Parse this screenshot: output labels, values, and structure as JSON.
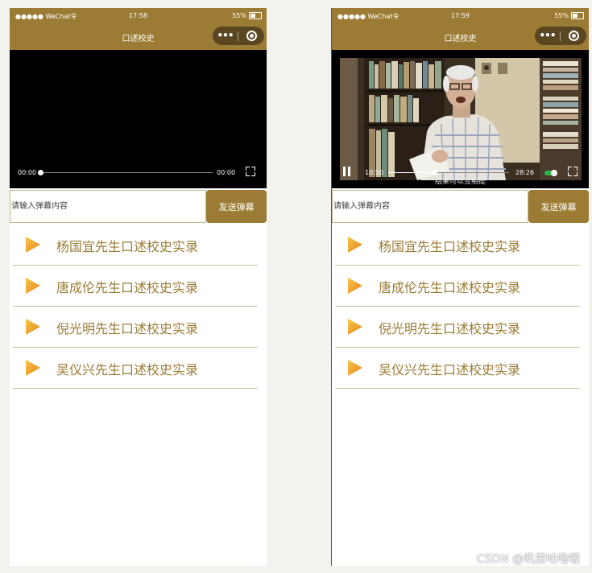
{
  "status_bar": {
    "carrier": "●●●●● WeChat令",
    "battery_pct": "55%"
  },
  "left": {
    "time": "17:58",
    "title": "口述校史",
    "capsule_dots": "•••",
    "video": {
      "current": "00:00",
      "duration": "00:00",
      "progress": 0
    },
    "danmu_placeholder": "请输入弹幕内容",
    "send_label": "发送弹幕",
    "items": [
      {
        "label": "杨国宜先生口述校史实录"
      },
      {
        "label": "唐成伦先生口述校史实录"
      },
      {
        "label": "倪光明先生口述校史实录"
      },
      {
        "label": "吴仪兴先生口述校史实录"
      }
    ]
  },
  "right": {
    "time": "17:59",
    "title": "口述校史",
    "capsule_dots": "•••",
    "video": {
      "current": "10:50",
      "duration": "28:26",
      "progress": 0.38,
      "danmu_text": "结果可以互相提"
    },
    "danmu_placeholder": "请输入弹幕内容",
    "send_label": "发送弹幕",
    "items": [
      {
        "label": "杨国宜先生口述校史实录"
      },
      {
        "label": "唐成伦先生口述校史实录"
      },
      {
        "label": "倪光明先生口述校史实录"
      },
      {
        "label": "吴仪兴先生口述校史实录"
      }
    ]
  },
  "watermark": "CSDN @叽里咕噜喔",
  "colors": {
    "brand": "#9c7c34",
    "play_icon": "#f0a020",
    "divider": "#cbbd98"
  },
  "icons": [
    "signal-icon",
    "battery-icon",
    "more-dots-icon",
    "target-icon",
    "fullscreen-icon",
    "pause-icon",
    "danmu-toggle-icon",
    "play-triangle-icon"
  ]
}
